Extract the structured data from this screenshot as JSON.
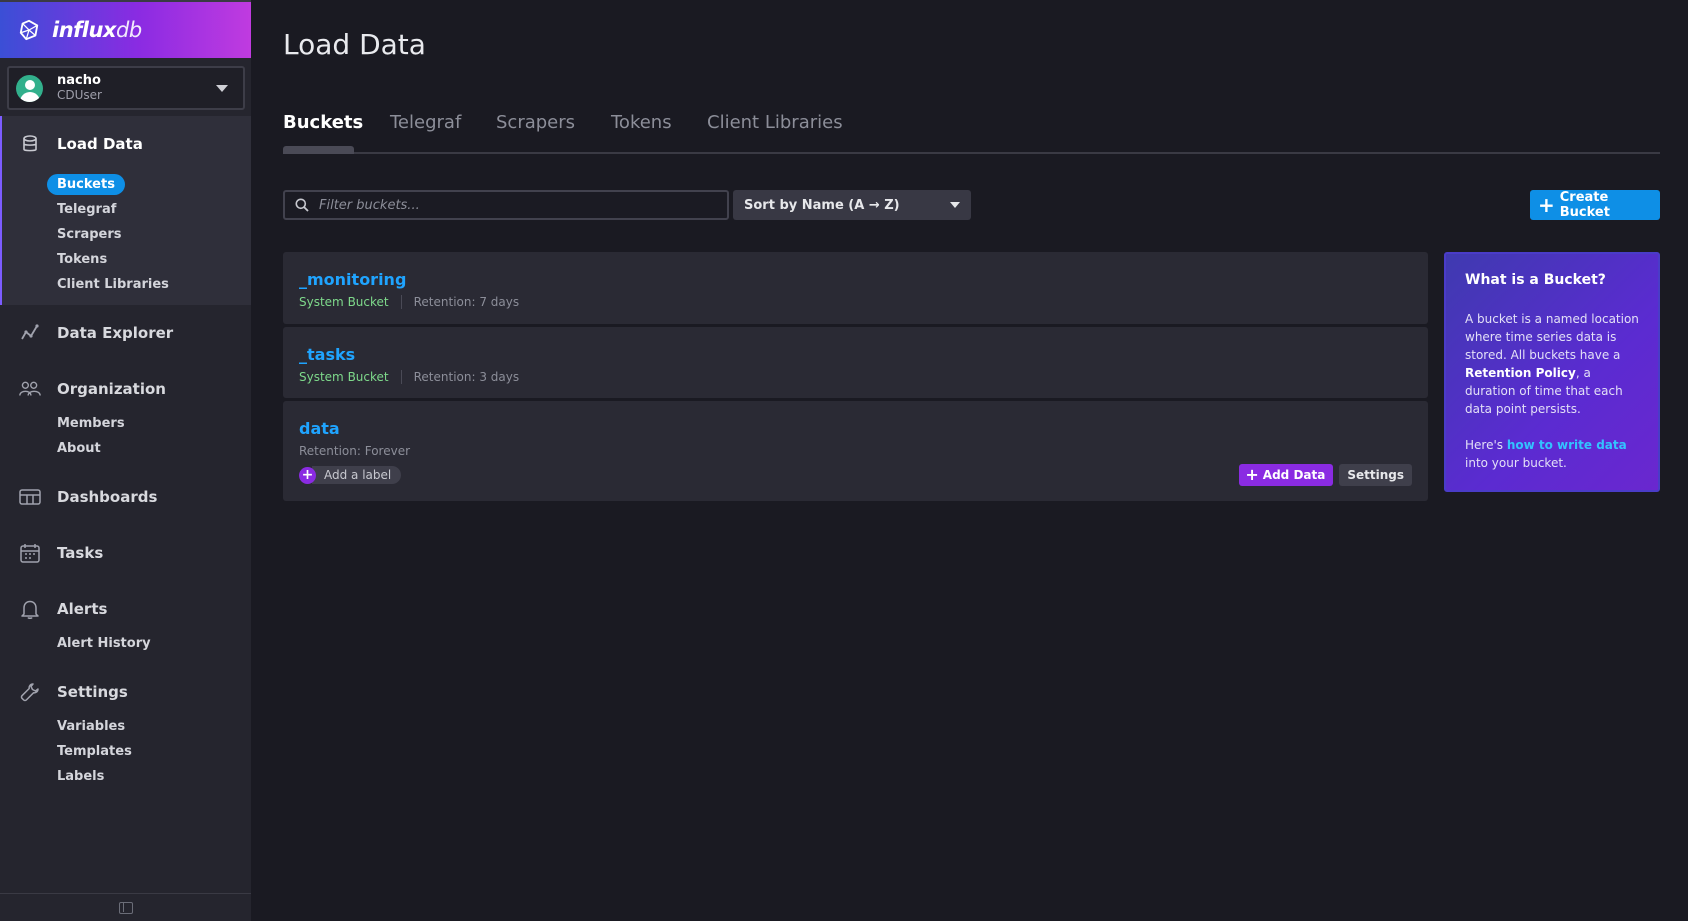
{
  "brand": {
    "name_bold": "influx",
    "name_light": "db",
    "logo_icon": "influxdb-logo-icon"
  },
  "user": {
    "name": "nacho",
    "role": "CDUser"
  },
  "sidebar": {
    "sections": [
      {
        "label": "Load Data",
        "icon": "database-icon",
        "active": true,
        "items": [
          "Buckets",
          "Telegraf",
          "Scrapers",
          "Tokens",
          "Client Libraries"
        ],
        "selected": "Buckets"
      },
      {
        "label": "Data Explorer",
        "icon": "graph-line-icon",
        "items": []
      },
      {
        "label": "Organization",
        "icon": "users-icon",
        "items": [
          "Members",
          "About"
        ]
      },
      {
        "label": "Dashboards",
        "icon": "dashboard-grid-icon",
        "items": []
      },
      {
        "label": "Tasks",
        "icon": "calendar-icon",
        "items": []
      },
      {
        "label": "Alerts",
        "icon": "bell-icon",
        "items": [
          "Alert History"
        ]
      },
      {
        "label": "Settings",
        "icon": "wrench-icon",
        "items": [
          "Variables",
          "Templates",
          "Labels"
        ]
      }
    ]
  },
  "page": {
    "title": "Load Data"
  },
  "tabs": [
    "Buckets",
    "Telegraf",
    "Scrapers",
    "Tokens",
    "Client Libraries"
  ],
  "active_tab": "Buckets",
  "controls": {
    "filter_placeholder": "Filter buckets...",
    "sort_label": "Sort by Name (A → Z)",
    "create_label": "Create Bucket"
  },
  "buckets": [
    {
      "name": "_monitoring",
      "system": "System Bucket",
      "retention": "Retention: 7 days"
    },
    {
      "name": "_tasks",
      "system": "System Bucket",
      "retention": "Retention: 3 days"
    },
    {
      "name": "data",
      "retention": "Retention: Forever",
      "label_text": "Add a label",
      "add_data_label": "Add Data",
      "settings_label": "Settings"
    }
  ],
  "help": {
    "title": "What is a Bucket?",
    "body_1": "A bucket is a named location where time series data is stored. All buckets have a ",
    "body_bold": "Retention Policy",
    "body_2": ", a duration of time that each data point persists.",
    "footer_1": "Here's ",
    "footer_link": "how to write data",
    "footer_2": " into your bucket."
  },
  "colors": {
    "accent": "#0e8fe6",
    "purple": "#8a2be2",
    "system_badge": "#7ed98b"
  }
}
